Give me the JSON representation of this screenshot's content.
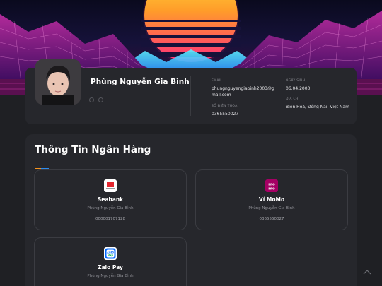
{
  "profile": {
    "name": "Phùng Nguyễn Gia Bình",
    "email_label": "EMAIL",
    "email": "phungnguyengiabinh2003@gmail.com",
    "phone_label": "SỐ ĐIỆN THOẠI",
    "phone": "0365550027",
    "birthday_label": "NGÀY SINH",
    "birthday": "06.04.2003",
    "address_label": "ĐỊA CHỈ",
    "address": "Biên Hoà, Đồng Nai, Việt Nam"
  },
  "bank_section": {
    "title": "Thông Tin Ngân Hàng",
    "accent_colors": [
      "#f7931e",
      "#2d8cf0"
    ],
    "cards": [
      {
        "name": "Seabank",
        "holder": "Phùng Nguyễn Gia Bình",
        "account": "000001707128",
        "logo": "seabank-logo"
      },
      {
        "name": "Ví MoMo",
        "holder": "Phùng Nguyễn Gia Bình",
        "account": "0365550027",
        "logo": "momo-logo",
        "logo_text": "mo mo"
      },
      {
        "name": "Zalo Pay",
        "holder": "Phùng Nguyễn Gia Bình",
        "account": "",
        "logo": "zalopay-logo",
        "logo_text": "Zalo Pay"
      }
    ]
  },
  "icons": {
    "scroll_top": "chevron-up-icon"
  }
}
